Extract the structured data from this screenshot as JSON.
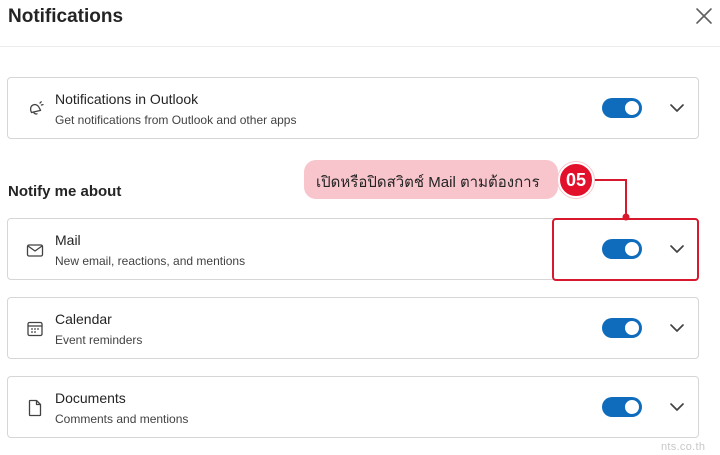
{
  "header": {
    "title": "Notifications",
    "close_icon": "close-icon"
  },
  "outlook_card": {
    "icon": "notification-bell-icon",
    "title": "Notifications in Outlook",
    "description": "Get notifications from Outlook and other apps",
    "toggle_on": true
  },
  "section": {
    "title": "Notify me about"
  },
  "items": [
    {
      "icon": "mail-icon",
      "title": "Mail",
      "description": "New email, reactions, and mentions",
      "toggle_on": true
    },
    {
      "icon": "calendar-icon",
      "title": "Calendar",
      "description": "Event reminders",
      "toggle_on": true
    },
    {
      "icon": "document-icon",
      "title": "Documents",
      "description": "Comments and mentions",
      "toggle_on": true
    }
  ],
  "annotation": {
    "text": "เปิดหรือปิดสวิตช์ Mail ตามต้องการ",
    "step": "05"
  },
  "watermark": "nts.co.th",
  "colors": {
    "toggle_on": "#0f6cbd",
    "annotation_red": "#e3102b",
    "bubble_pink": "#f8c5cc"
  }
}
